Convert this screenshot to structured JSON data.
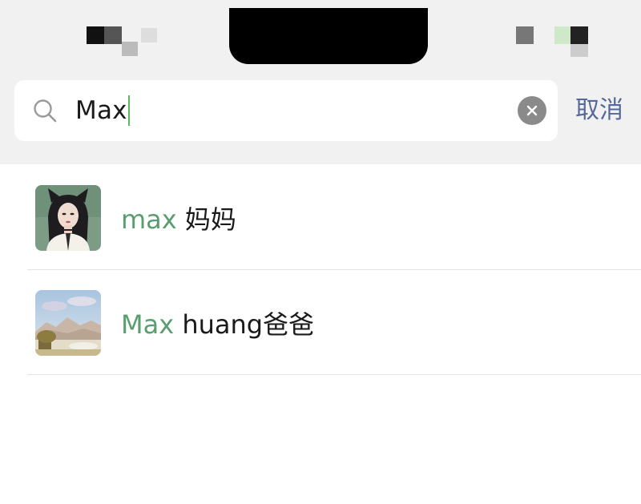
{
  "search": {
    "query": "Max",
    "cancel_label": "取消"
  },
  "results": [
    {
      "match": "max",
      "rest": " 妈妈",
      "avatar": "girl-portrait-avatar"
    },
    {
      "match": "Max",
      "rest": " huang爸爸",
      "avatar": "landscape-painting-avatar"
    }
  ],
  "colors": {
    "highlight": "#5a9e6f",
    "cancel": "#56699a",
    "header_bg": "#f1f1f1"
  }
}
